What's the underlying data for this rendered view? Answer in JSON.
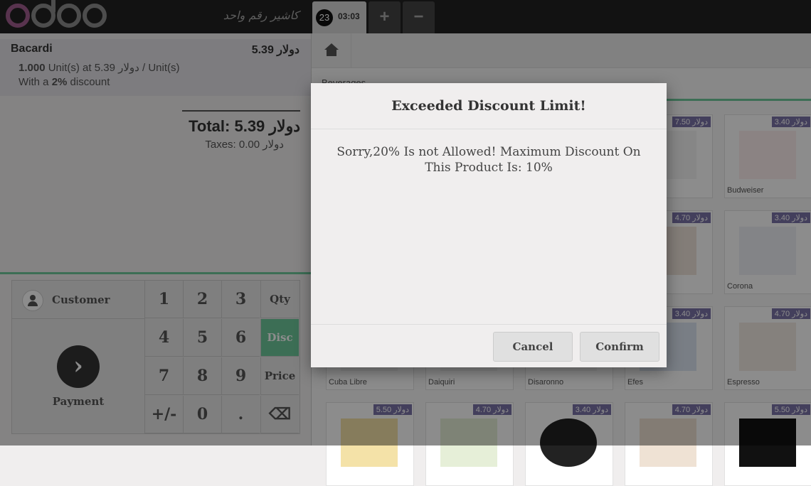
{
  "header": {
    "logo_text": "odoo",
    "cashier": "كاشير رقم واحد",
    "order_number": "23",
    "order_time": "03:03",
    "add_label": "+",
    "remove_label": "−"
  },
  "order": {
    "line": {
      "product": "Bacardi",
      "price": "5.39 دولار",
      "qty": "1.000",
      "unit_info": " Unit(s) at 5.39 دولار / Unit(s)",
      "discount_prefix": "With a ",
      "discount": "2%",
      "discount_suffix": " discount"
    },
    "total": "Total: 5.39 دولار",
    "taxes": "Taxes: 0.00 دولار"
  },
  "pad": {
    "customer": "Customer",
    "payment": "Payment",
    "payment_icon": "chevron-right-icon",
    "keys": [
      "1",
      "2",
      "3",
      "4",
      "5",
      "6",
      "7",
      "8",
      "9",
      "+/-",
      "0",
      "."
    ],
    "qty": "Qty",
    "disc": "Disc",
    "price": "Price",
    "backspace": "⌫"
  },
  "products": {
    "category": "Beverages",
    "items": [
      {
        "name": "",
        "price": "دولار 7.50"
      },
      {
        "name": "Budweiser",
        "price": "3.40 دولار"
      },
      {
        "name": "",
        "price": "4.70 دولار"
      },
      {
        "name": "Corona",
        "price": "3.40 دولار"
      },
      {
        "name": "Cuba Libre",
        "price": ""
      },
      {
        "name": "Daiquiri",
        "price": ""
      },
      {
        "name": "Disaronno",
        "price": ""
      },
      {
        "name": "Efes",
        "price": "3.40 دولار"
      },
      {
        "name": "Espresso",
        "price": "4.70 دولار"
      },
      {
        "name": "",
        "price": "5.50 دولار"
      },
      {
        "name": "",
        "price": "4.70 دولار"
      },
      {
        "name": "",
        "price": "3.40 دولار"
      },
      {
        "name": "",
        "price": "4.70 دولار"
      },
      {
        "name": "",
        "price": "5.50 دولار"
      }
    ]
  },
  "dialog": {
    "title": "Exceeded Discount Limit!",
    "message": "Sorry,20% Is not Allowed! Maximum Discount On This Product Is: 10%",
    "cancel": "Cancel",
    "confirm": "Confirm"
  },
  "colors": {
    "accent": "#6ec89b",
    "badge": "#7b73a8",
    "logo_purple": "#a05d8e"
  }
}
